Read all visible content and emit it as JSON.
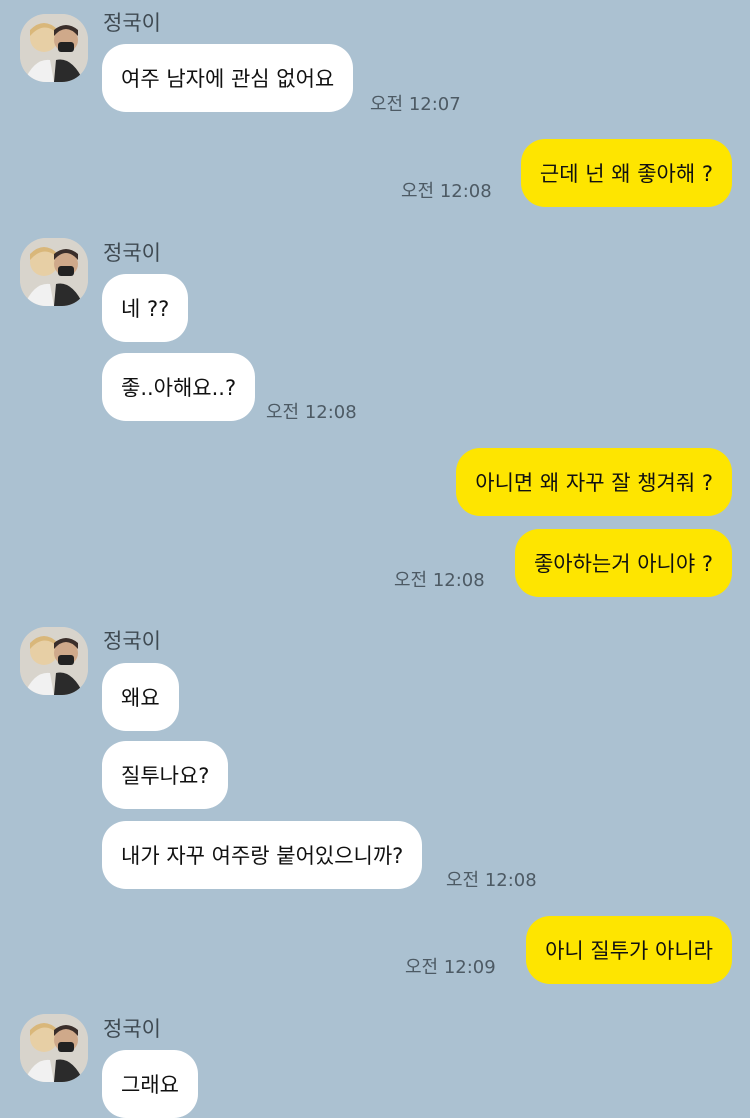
{
  "contact": {
    "name": "정국이"
  },
  "messages": {
    "m1": "여주 남자에 관심 없어요",
    "m2": "근데 넌 왜 좋아해 ?",
    "m3": "네 ??",
    "m4": "좋..아해요..?",
    "m5": "아니면 왜 자꾸 잘 챙겨줘 ?",
    "m6": "좋아하는거 아니야 ?",
    "m7": "왜요",
    "m8": "질투나요?",
    "m9": "내가 자꾸 여주랑 붙어있으니까?",
    "m10": "아니 질투가 아니라",
    "m11": "그래요"
  },
  "times": {
    "t1": "오전 12:07",
    "t2": "오전 12:08",
    "t3": "오전 12:08",
    "t4": "오전 12:08",
    "t5": "오전 12:08",
    "t6": "오전 12:09"
  },
  "colors": {
    "background": "#abc1d1",
    "incoming_bubble": "#ffffff",
    "outgoing_bubble": "#fee500"
  }
}
